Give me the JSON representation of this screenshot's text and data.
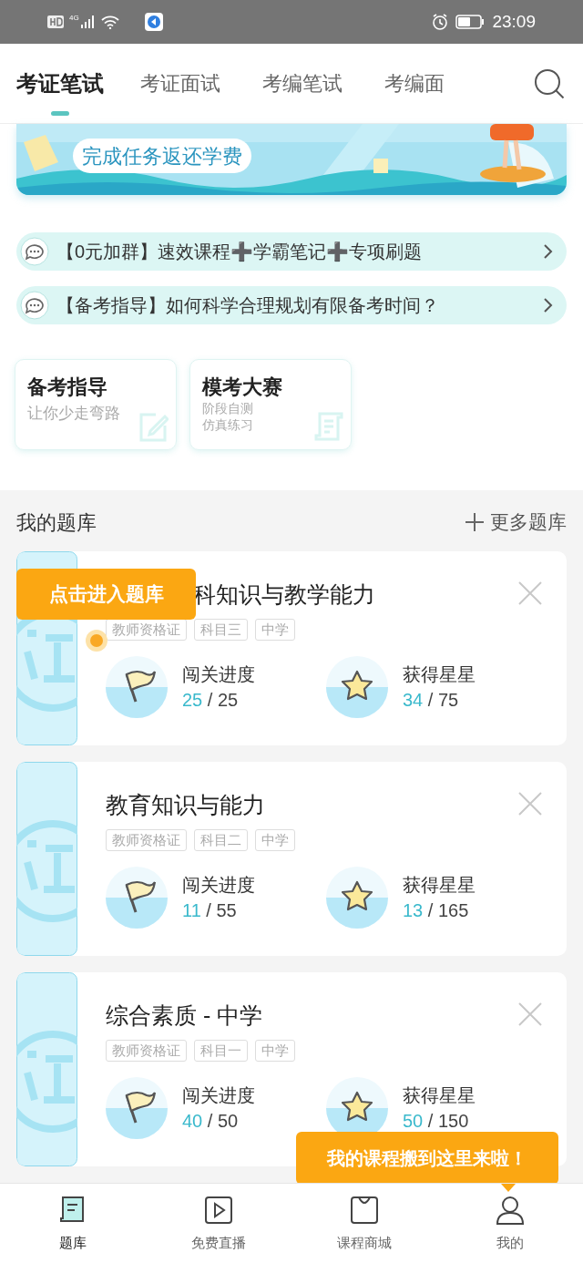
{
  "status_bar": {
    "network": "4G",
    "time": "23:09"
  },
  "tabs": [
    {
      "label": "考证笔试",
      "selected": true
    },
    {
      "label": "考证面试",
      "selected": false
    },
    {
      "label": "考编笔试",
      "selected": false
    },
    {
      "label": "考编面",
      "selected": false
    }
  ],
  "banner": {
    "kind": "picture",
    "label": "完成任务返还学费"
  },
  "notices": [
    {
      "text": "【0元加群】速效课程➕学霸笔记➕专项刷题"
    },
    {
      "text": "【备考指导】如何科学合理规划有限备考时间？"
    }
  ],
  "shortcuts": [
    {
      "title": "备考指导",
      "lines": [
        "让你少走弯路"
      ],
      "kind": "edit"
    },
    {
      "title": "模考大赛",
      "lines": [
        "阶段自测",
        "仿真练习"
      ],
      "kind": "scroll"
    }
  ],
  "bank": {
    "title": "我的题库",
    "more": "更多题库"
  },
  "courses": [
    {
      "title": "科知识与教学能力",
      "tags": [
        "教师资格证",
        "科目三",
        "中学"
      ],
      "progress": {
        "label": "闯关进度",
        "done": "25",
        "total": "/ 25"
      },
      "stars": {
        "label": "获得星星",
        "done": "34",
        "total": "/ 75"
      }
    },
    {
      "title": "教育知识与能力",
      "tags": [
        "教师资格证",
        "科目二",
        "中学"
      ],
      "progress": {
        "label": "闯关进度",
        "done": "11",
        "total": "/ 55"
      },
      "stars": {
        "label": "获得星星",
        "done": "13",
        "total": "/ 165"
      }
    },
    {
      "title": "综合素质 - 中学",
      "tags": [
        "教师资格证",
        "科目一",
        "中学"
      ],
      "progress": {
        "label": "闯关进度",
        "done": "40",
        "total": "/ 50"
      },
      "stars": {
        "label": "获得星星",
        "done": "50",
        "total": "/ 150"
      }
    }
  ],
  "tips": [
    {
      "text": "点击进入题库"
    },
    {
      "text": "我的课程搬到这里来啦！"
    }
  ],
  "nav": [
    {
      "label": "题库",
      "kind": "book",
      "selected": true
    },
    {
      "label": "免费直播",
      "kind": "play",
      "selected": false
    },
    {
      "label": "课程商城",
      "kind": "bag",
      "selected": false
    },
    {
      "label": "我的",
      "kind": "person",
      "selected": false
    }
  ]
}
